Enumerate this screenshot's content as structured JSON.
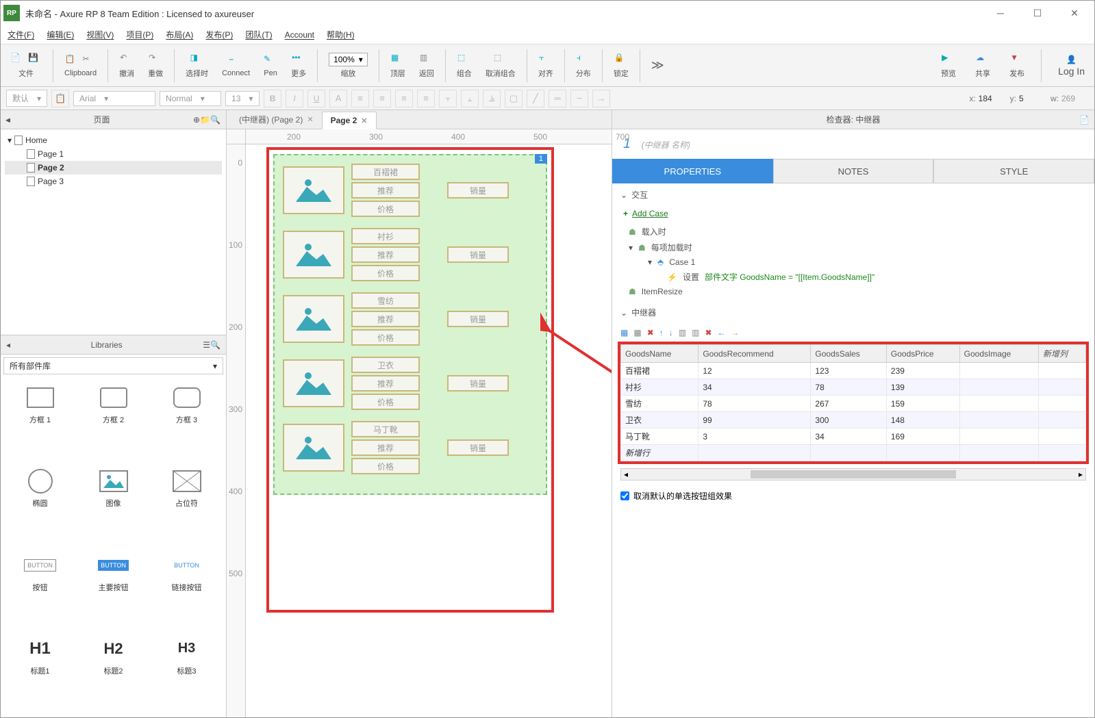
{
  "titlebar": {
    "text": "未命名 - Axure RP 8 Team Edition : Licensed to axureuser"
  },
  "menubar": [
    "文件(F)",
    "编辑(E)",
    "视图(V)",
    "项目(P)",
    "布局(A)",
    "发布(P)",
    "团队(T)",
    "Account",
    "帮助(H)"
  ],
  "toolbar": {
    "file": "文件",
    "clipboard": "Clipboard",
    "undo": "撤消",
    "redo": "重做",
    "select": "选择时",
    "connect": "Connect",
    "pen": "Pen",
    "more": "更多",
    "zoom_val": "100%",
    "zoom": "缩放",
    "front": "顶层",
    "back": "返回",
    "group": "组合",
    "ungroup": "取消组合",
    "align": "对齐",
    "distribute": "分布",
    "lock": "锁定",
    "preview": "预览",
    "share": "共享",
    "publish": "发布",
    "login": "Log In",
    "more_arrow": "≫"
  },
  "stylebar": {
    "preset": "默认",
    "font": "Arial",
    "weight": "Normal",
    "size": "13",
    "x_lbl": "x:",
    "x": "184",
    "y_lbl": "y:",
    "y": "5",
    "w_lbl": "w:",
    "w": "269"
  },
  "pages_panel": {
    "title": "页面",
    "home": "Home",
    "p1": "Page 1",
    "p2": "Page 2",
    "p3": "Page 3"
  },
  "tabs": {
    "t1": "(中继器) (Page 2)",
    "t2": "Page 2"
  },
  "ruler_h": [
    "200",
    "300",
    "400",
    "500",
    "700"
  ],
  "ruler_v": [
    "0",
    "100",
    "200",
    "300",
    "400",
    "500"
  ],
  "repeater": {
    "badge": "1",
    "rows": [
      {
        "name": "百褶裙",
        "rec": "推荐",
        "price": "价格",
        "sales": "销量"
      },
      {
        "name": "衬衫",
        "rec": "推荐",
        "price": "价格",
        "sales": "销量"
      },
      {
        "name": "雪纺",
        "rec": "推荐",
        "price": "价格",
        "sales": "销量"
      },
      {
        "name": "卫衣",
        "rec": "推荐",
        "price": "价格",
        "sales": "销量"
      },
      {
        "name": "马丁靴",
        "rec": "推荐",
        "price": "价格",
        "sales": "销量"
      }
    ]
  },
  "libraries": {
    "title": "Libraries",
    "all": "所有部件库",
    "items": [
      "方框 1",
      "方框 2",
      "方框 3",
      "椭圆",
      "图像",
      "占位符",
      "按钮",
      "主要按钮",
      "链接按钮",
      "标题1",
      "标题2",
      "标题3"
    ],
    "btn": "BUTTON",
    "h1": "H1",
    "h2": "H2",
    "h3": "H3"
  },
  "inspector": {
    "title": "检查器: 中继器",
    "name_num": "1",
    "name": "(中继器 名称)",
    "tab_props": "PROPERTIES",
    "tab_notes": "NOTES",
    "tab_style": "STYLE",
    "sec_interact": "交互",
    "add_case": "Add Case",
    "evt_load": "载入时",
    "evt_item": "每项加载时",
    "case1": "Case 1",
    "action": "设置 部件文字 GoodsName = \"[[Item.GoodsName]]\"",
    "action_pre": "设置 ",
    "action_green": "部件文字 GoodsName = \"[[Item.GoodsName]]\"",
    "evt_resize": "ItemResize",
    "sec_repeater": "中继器",
    "cols": [
      "GoodsName",
      "GoodsRecommend",
      "GoodsSales",
      "GoodsPrice",
      "GoodsImage"
    ],
    "add_col": "新增列",
    "data": [
      [
        "百褶裙",
        "12",
        "123",
        "239",
        ""
      ],
      [
        "衬衫",
        "34",
        "78",
        "139",
        ""
      ],
      [
        "雪纺",
        "78",
        "267",
        "159",
        ""
      ],
      [
        "卫衣",
        "99",
        "300",
        "148",
        ""
      ],
      [
        "马丁靴",
        "3",
        "34",
        "169",
        ""
      ]
    ],
    "add_row": "新增行",
    "checkbox": "取消默认的单选按钮组效果"
  },
  "chart_data": {
    "type": "table",
    "title": "中继器 dataset",
    "columns": [
      "GoodsName",
      "GoodsRecommend",
      "GoodsSales",
      "GoodsPrice",
      "GoodsImage"
    ],
    "rows": [
      [
        "百褶裙",
        12,
        123,
        239,
        null
      ],
      [
        "衬衫",
        34,
        78,
        139,
        null
      ],
      [
        "雪纺",
        78,
        267,
        159,
        null
      ],
      [
        "卫衣",
        99,
        300,
        148,
        null
      ],
      [
        "马丁靴",
        3,
        34,
        169,
        null
      ]
    ]
  }
}
